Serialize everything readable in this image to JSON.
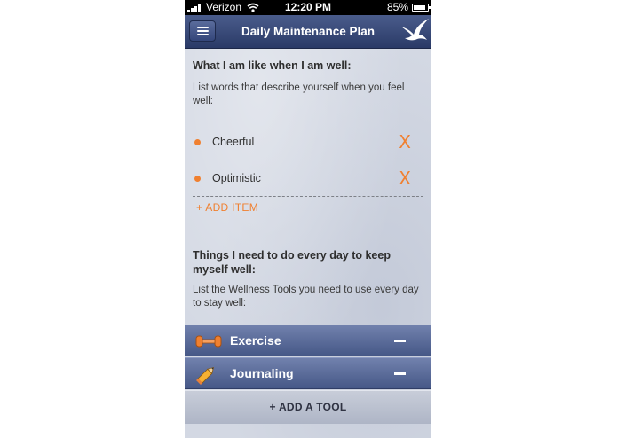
{
  "status_bar": {
    "carrier": "Verizon",
    "time": "12:20 PM",
    "battery": "85%",
    "battery_level": 0.85,
    "icons": [
      "signal-icon",
      "wifi-icon",
      "battery-icon"
    ]
  },
  "navbar": {
    "title": "Daily Maintenance Plan",
    "menu_icon": "hamburger-menu-icon",
    "logo_icon": "swallow-bird-icon"
  },
  "section_well": {
    "heading": "What I am like when I am well:",
    "description": "List words that describe yourself when you feel well:",
    "items": [
      {
        "label": "Cheerful",
        "remove": "X"
      },
      {
        "label": "Optimistic",
        "remove": "X"
      }
    ],
    "add_label": "+ ADD ITEM"
  },
  "section_daily": {
    "heading": "Things I need to do every day to keep myself well:",
    "description": "List the Wellness Tools you need to use every day to stay well:",
    "tools": [
      {
        "label": "Exercise",
        "icon": "dumbbell-icon"
      },
      {
        "label": "Journaling",
        "icon": "pencil-icon"
      }
    ],
    "add_label": "+ ADD A TOOL"
  },
  "colors": {
    "accent": "#f08030",
    "navbar": "#34467a",
    "tool_bar": "#5a6a99",
    "background": "#d3d8e3"
  }
}
